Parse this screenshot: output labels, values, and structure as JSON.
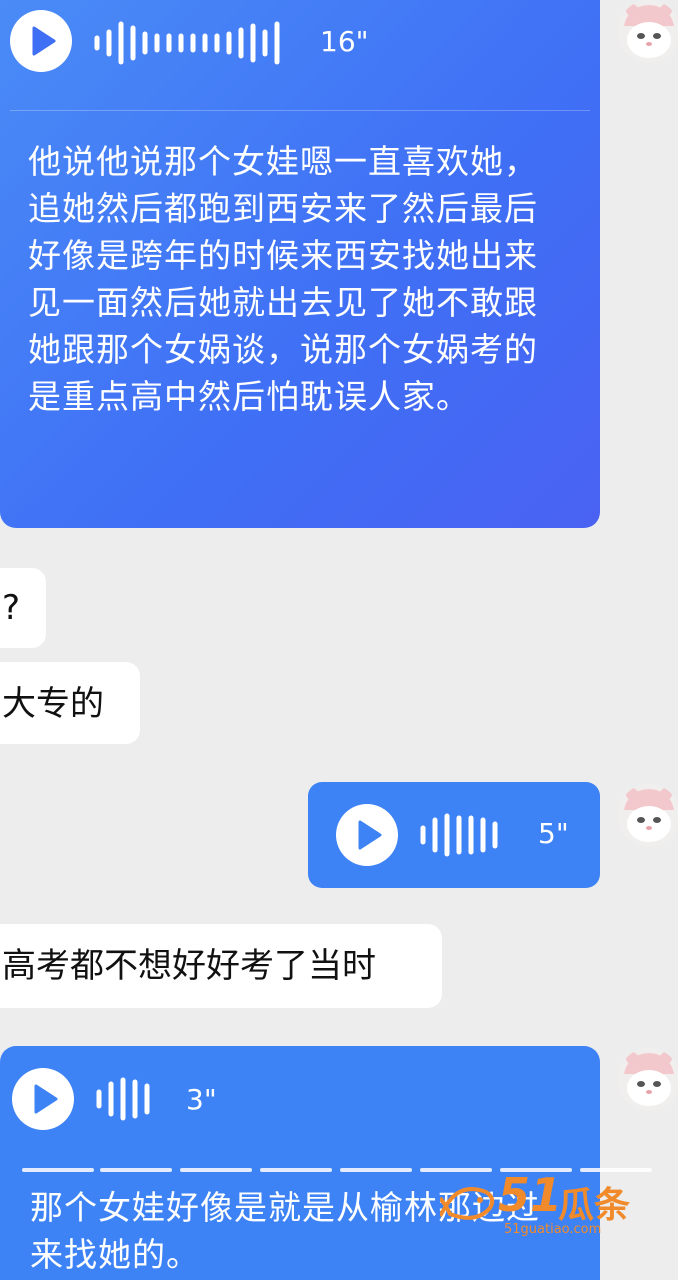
{
  "messages": [
    {
      "duration": "16\"",
      "transcript": "他说他说那个女娃嗯一直喜欢她，追她然后都跑到西安来了然后最后好像是跨年的时候来西安找她出来见一面然后她就出去见了她不敢跟她跟那个女娲谈，说那个女娲考的是重点高中然后怕耽误人家。"
    },
    {
      "text": "?"
    },
    {
      "text": "大专的"
    },
    {
      "duration": "5\""
    },
    {
      "text": "高考都不想好好考了当时"
    },
    {
      "duration": "3\"",
      "transcript": "那个女娃好像是就是从榆林那边过来找她的。"
    }
  ],
  "watermark": {
    "number": "51",
    "name": "瓜条",
    "url": "51guatiao.com"
  },
  "colors": {
    "outgoing_bubble": "#3f6ff5",
    "incoming_bubble": "#ffffff",
    "background": "#ededed",
    "watermark": "#f08a2a"
  },
  "icons": [
    "play-icon",
    "voice-wave-icon",
    "avatar-icon"
  ]
}
